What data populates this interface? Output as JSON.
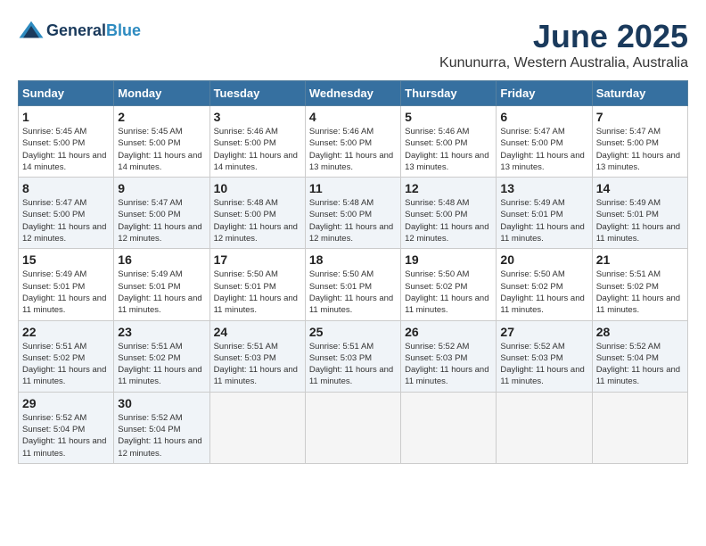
{
  "header": {
    "logo_line1": "General",
    "logo_line2": "Blue",
    "month": "June 2025",
    "location": "Kununurra, Western Australia, Australia"
  },
  "days_of_week": [
    "Sunday",
    "Monday",
    "Tuesday",
    "Wednesday",
    "Thursday",
    "Friday",
    "Saturday"
  ],
  "weeks": [
    [
      {
        "day": "1",
        "sunrise": "5:45 AM",
        "sunset": "5:00 PM",
        "daylight": "11 hours and 14 minutes."
      },
      {
        "day": "2",
        "sunrise": "5:45 AM",
        "sunset": "5:00 PM",
        "daylight": "11 hours and 14 minutes."
      },
      {
        "day": "3",
        "sunrise": "5:46 AM",
        "sunset": "5:00 PM",
        "daylight": "11 hours and 14 minutes."
      },
      {
        "day": "4",
        "sunrise": "5:46 AM",
        "sunset": "5:00 PM",
        "daylight": "11 hours and 13 minutes."
      },
      {
        "day": "5",
        "sunrise": "5:46 AM",
        "sunset": "5:00 PM",
        "daylight": "11 hours and 13 minutes."
      },
      {
        "day": "6",
        "sunrise": "5:47 AM",
        "sunset": "5:00 PM",
        "daylight": "11 hours and 13 minutes."
      },
      {
        "day": "7",
        "sunrise": "5:47 AM",
        "sunset": "5:00 PM",
        "daylight": "11 hours and 13 minutes."
      }
    ],
    [
      {
        "day": "8",
        "sunrise": "5:47 AM",
        "sunset": "5:00 PM",
        "daylight": "11 hours and 12 minutes."
      },
      {
        "day": "9",
        "sunrise": "5:47 AM",
        "sunset": "5:00 PM",
        "daylight": "11 hours and 12 minutes."
      },
      {
        "day": "10",
        "sunrise": "5:48 AM",
        "sunset": "5:00 PM",
        "daylight": "11 hours and 12 minutes."
      },
      {
        "day": "11",
        "sunrise": "5:48 AM",
        "sunset": "5:00 PM",
        "daylight": "11 hours and 12 minutes."
      },
      {
        "day": "12",
        "sunrise": "5:48 AM",
        "sunset": "5:00 PM",
        "daylight": "11 hours and 12 minutes."
      },
      {
        "day": "13",
        "sunrise": "5:49 AM",
        "sunset": "5:01 PM",
        "daylight": "11 hours and 11 minutes."
      },
      {
        "day": "14",
        "sunrise": "5:49 AM",
        "sunset": "5:01 PM",
        "daylight": "11 hours and 11 minutes."
      }
    ],
    [
      {
        "day": "15",
        "sunrise": "5:49 AM",
        "sunset": "5:01 PM",
        "daylight": "11 hours and 11 minutes."
      },
      {
        "day": "16",
        "sunrise": "5:49 AM",
        "sunset": "5:01 PM",
        "daylight": "11 hours and 11 minutes."
      },
      {
        "day": "17",
        "sunrise": "5:50 AM",
        "sunset": "5:01 PM",
        "daylight": "11 hours and 11 minutes."
      },
      {
        "day": "18",
        "sunrise": "5:50 AM",
        "sunset": "5:01 PM",
        "daylight": "11 hours and 11 minutes."
      },
      {
        "day": "19",
        "sunrise": "5:50 AM",
        "sunset": "5:02 PM",
        "daylight": "11 hours and 11 minutes."
      },
      {
        "day": "20",
        "sunrise": "5:50 AM",
        "sunset": "5:02 PM",
        "daylight": "11 hours and 11 minutes."
      },
      {
        "day": "21",
        "sunrise": "5:51 AM",
        "sunset": "5:02 PM",
        "daylight": "11 hours and 11 minutes."
      }
    ],
    [
      {
        "day": "22",
        "sunrise": "5:51 AM",
        "sunset": "5:02 PM",
        "daylight": "11 hours and 11 minutes."
      },
      {
        "day": "23",
        "sunrise": "5:51 AM",
        "sunset": "5:02 PM",
        "daylight": "11 hours and 11 minutes."
      },
      {
        "day": "24",
        "sunrise": "5:51 AM",
        "sunset": "5:03 PM",
        "daylight": "11 hours and 11 minutes."
      },
      {
        "day": "25",
        "sunrise": "5:51 AM",
        "sunset": "5:03 PM",
        "daylight": "11 hours and 11 minutes."
      },
      {
        "day": "26",
        "sunrise": "5:52 AM",
        "sunset": "5:03 PM",
        "daylight": "11 hours and 11 minutes."
      },
      {
        "day": "27",
        "sunrise": "5:52 AM",
        "sunset": "5:03 PM",
        "daylight": "11 hours and 11 minutes."
      },
      {
        "day": "28",
        "sunrise": "5:52 AM",
        "sunset": "5:04 PM",
        "daylight": "11 hours and 11 minutes."
      }
    ],
    [
      {
        "day": "29",
        "sunrise": "5:52 AM",
        "sunset": "5:04 PM",
        "daylight": "11 hours and 11 minutes."
      },
      {
        "day": "30",
        "sunrise": "5:52 AM",
        "sunset": "5:04 PM",
        "daylight": "11 hours and 12 minutes."
      },
      null,
      null,
      null,
      null,
      null
    ]
  ],
  "labels": {
    "sunrise": "Sunrise:",
    "sunset": "Sunset:",
    "daylight": "Daylight:"
  }
}
